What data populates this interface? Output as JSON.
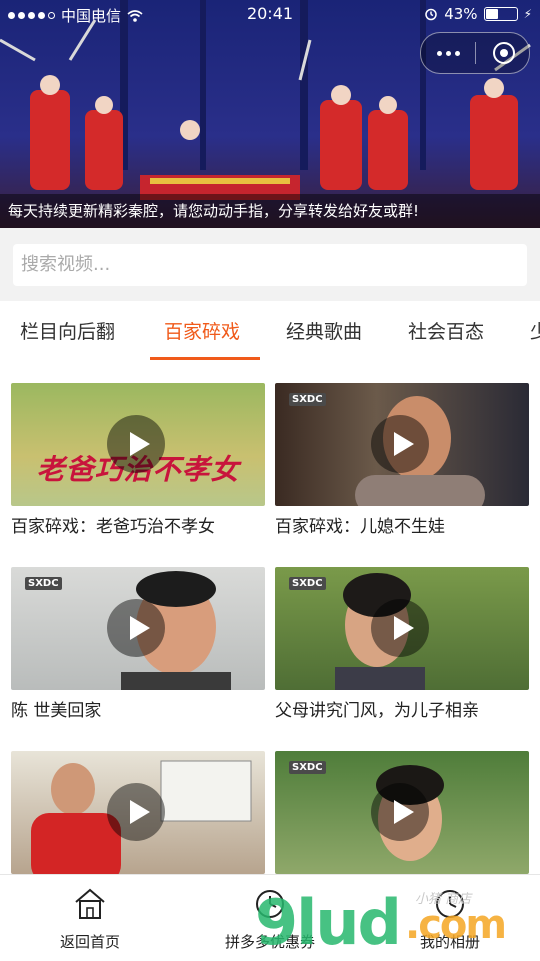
{
  "status_bar": {
    "carrier": "中国电信",
    "time": "20:41",
    "battery": "43%",
    "battery_level": 0.43
  },
  "banner": {
    "caption": "每天持续更新精彩秦腔，请您动动手指，分享转发给好友或群!"
  },
  "search": {
    "placeholder": "搜索视频..."
  },
  "tabs": [
    {
      "label": "栏目向后翻",
      "active": false
    },
    {
      "label": "百家碎戏",
      "active": true
    },
    {
      "label": "经典歌曲",
      "active": false
    },
    {
      "label": "社会百态",
      "active": false
    },
    {
      "label": "少",
      "active": false
    }
  ],
  "videos": [
    {
      "title": "百家碎戏：老爸巧治不孝女",
      "overlay_text": "老爸巧治不孝女"
    },
    {
      "title": "百家碎戏：儿媳不生娃",
      "channel_tag": "SXDC"
    },
    {
      "title": "陈 世美回家",
      "channel_tag": "SXDC"
    },
    {
      "title": "父母讲究门风，为儿子相亲",
      "channel_tag": "SXDC"
    },
    {
      "title": "",
      "channel_tag": ""
    },
    {
      "title": "",
      "channel_tag": "SXDC"
    }
  ],
  "bottom_nav": [
    {
      "label": "返回首页",
      "icon": "house-icon"
    },
    {
      "label": "拼多多优惠券",
      "icon": "clock-icon"
    },
    {
      "label": "我的相册",
      "icon": "clock-icon"
    }
  ],
  "watermark": {
    "brand": "9lud",
    "suffix": ".com",
    "shop": "小猪 商店"
  },
  "colors": {
    "accent": "#f05a1a",
    "search_bg": "#f2f2f2",
    "watermark_green": "#27b86e",
    "watermark_orange": "#f5a623"
  }
}
